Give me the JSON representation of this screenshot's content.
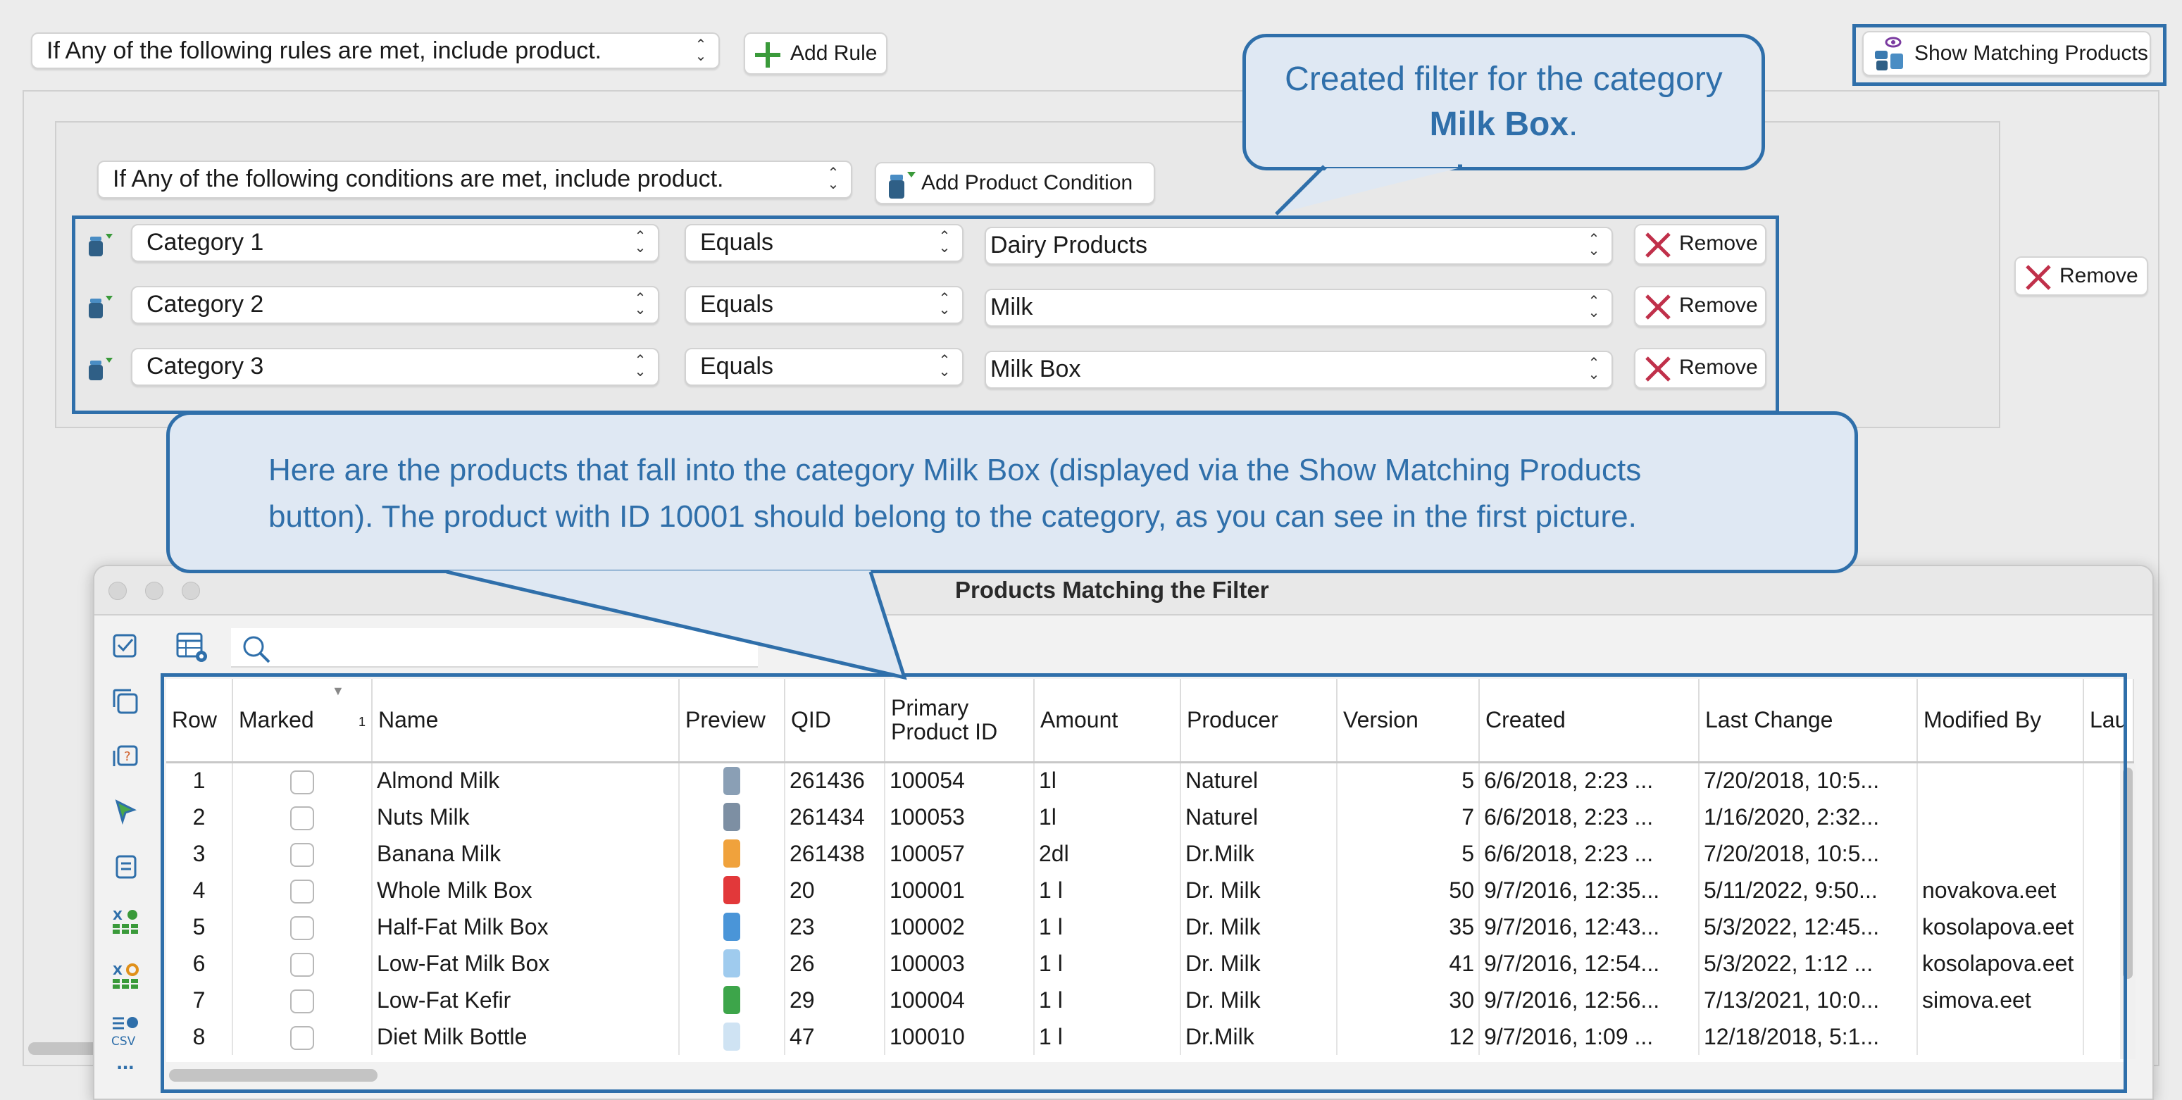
{
  "rule_selector": "If Any of the following rules are met, include product.",
  "add_rule_label": "Add Rule",
  "show_matching_label": "Show Matching Products",
  "outer_remove_label": "Remove",
  "condition_selector": "If Any of the following conditions are met, include product.",
  "add_condition_label": "Add Product Condition",
  "conditions": [
    {
      "attribute": "Category 1",
      "operator": "Equals",
      "value": "Dairy Products",
      "remove_label": "Remove"
    },
    {
      "attribute": "Category 2",
      "operator": "Equals",
      "value": "Milk",
      "remove_label": "Remove"
    },
    {
      "attribute": "Category 3",
      "operator": "Equals",
      "value": "Milk Box",
      "remove_label": "Remove"
    }
  ],
  "callout_top": {
    "line1": "Created filter for the category",
    "bold": "Milk Box",
    "suffix": "."
  },
  "callout_main": {
    "line1": "Here are the products that fall into the category Milk Box (displayed via the Show Matching Products",
    "line2": "button). The product with ID 10001 should belong to the category, as you can see in the first picture."
  },
  "window": {
    "title": "Products Matching the Filter",
    "search_placeholder": "",
    "sort_index": "1",
    "columns": [
      "Row",
      "Marked",
      "Name",
      "Preview",
      "QID",
      "Primary Product ID",
      "Amount",
      "Producer",
      "Version",
      "Created",
      "Last Change",
      "Modified By",
      "Lau"
    ],
    "rows": [
      {
        "row": "1",
        "name": "Almond Milk",
        "preview_color": "#8a9fb5",
        "qid": "261436",
        "ppid": "100054",
        "amount": "1l",
        "producer": "Naturel",
        "version": "5",
        "created": "6/6/2018, 2:23 ...",
        "last_change": "7/20/2018, 10:5...",
        "modified_by": ""
      },
      {
        "row": "2",
        "name": "Nuts Milk",
        "preview_color": "#7d8fa3",
        "qid": "261434",
        "ppid": "100053",
        "amount": "1l",
        "producer": "Naturel",
        "version": "7",
        "created": "6/6/2018, 2:23 ...",
        "last_change": "1/16/2020, 2:32...",
        "modified_by": ""
      },
      {
        "row": "3",
        "name": "Banana Milk",
        "preview_color": "#f0a23c",
        "qid": "261438",
        "ppid": "100057",
        "amount": "2dl",
        "producer": "Dr.Milk",
        "version": "5",
        "created": "6/6/2018, 2:23 ...",
        "last_change": "7/20/2018, 10:5...",
        "modified_by": ""
      },
      {
        "row": "4",
        "name": "Whole Milk Box",
        "preview_color": "#e2383a",
        "qid": "20",
        "ppid": "100001",
        "amount": "1 l",
        "producer": "Dr. Milk",
        "version": "50",
        "created": "9/7/2016, 12:35...",
        "last_change": "5/11/2022, 9:50...",
        "modified_by": "novakova.eet"
      },
      {
        "row": "5",
        "name": "Half-Fat Milk Box",
        "preview_color": "#4a95d8",
        "qid": "23",
        "ppid": "100002",
        "amount": "1 l",
        "producer": "Dr. Milk",
        "version": "35",
        "created": "9/7/2016, 12:43...",
        "last_change": "5/3/2022, 12:45...",
        "modified_by": "kosolapova.eet"
      },
      {
        "row": "6",
        "name": "Low-Fat Milk Box",
        "preview_color": "#9fcbee",
        "qid": "26",
        "ppid": "100003",
        "amount": "1 l",
        "producer": "Dr. Milk",
        "version": "41",
        "created": "9/7/2016, 12:54...",
        "last_change": "5/3/2022, 1:12 ...",
        "modified_by": "kosolapova.eet"
      },
      {
        "row": "7",
        "name": "Low-Fat Kefir",
        "preview_color": "#3da54a",
        "qid": "29",
        "ppid": "100004",
        "amount": "1 l",
        "producer": "Dr. Milk",
        "version": "30",
        "created": "9/7/2016, 12:56...",
        "last_change": "7/13/2021, 10:0...",
        "modified_by": "simova.eet"
      },
      {
        "row": "8",
        "name": "Diet Milk Bottle",
        "preview_color": "#cfe3f3",
        "qid": "47",
        "ppid": "100010",
        "amount": "1 l",
        "producer": "Dr.Milk",
        "version": "12",
        "created": "9/7/2016, 1:09 ...",
        "last_change": "12/18/2018, 5:1...",
        "modified_by": ""
      }
    ]
  },
  "sidebar_icons": [
    "checklist-icon",
    "copy-icon",
    "help-copy-icon",
    "cursor-icon",
    "notes-icon",
    "excel-import-icon",
    "excel-settings-icon",
    "csv-export-icon",
    "more-icon"
  ],
  "more_label": "...",
  "accent": "#2f6faa"
}
